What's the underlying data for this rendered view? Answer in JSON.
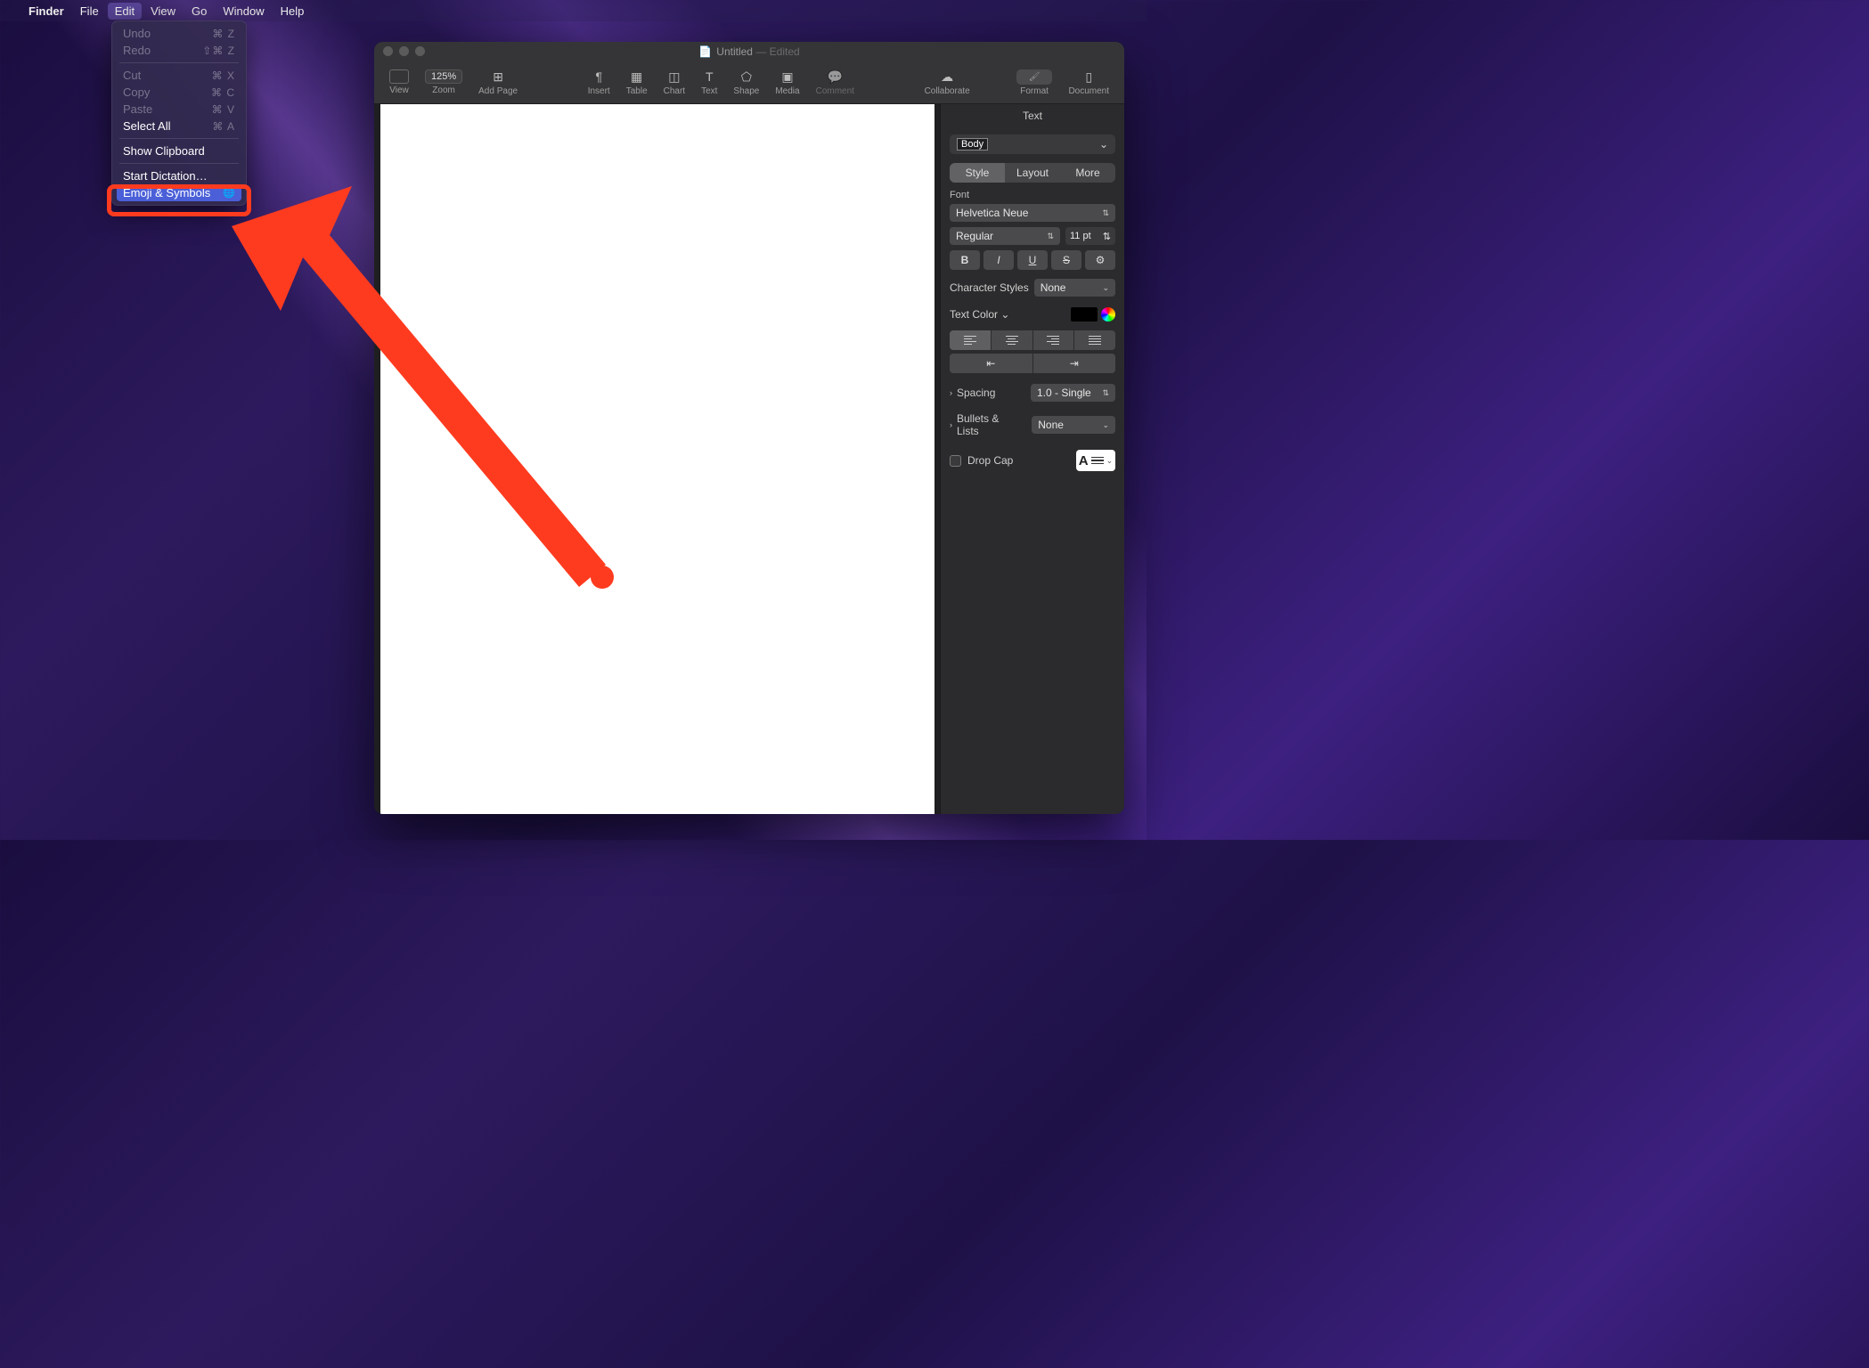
{
  "menubar": {
    "app": "Finder",
    "items": [
      "File",
      "Edit",
      "View",
      "Go",
      "Window",
      "Help"
    ],
    "active": "Edit"
  },
  "edit_menu": {
    "undo": "Undo",
    "undo_sc": "⌘ Z",
    "redo": "Redo",
    "redo_sc": "⇧⌘ Z",
    "cut": "Cut",
    "cut_sc": "⌘ X",
    "copy": "Copy",
    "copy_sc": "⌘ C",
    "paste": "Paste",
    "paste_sc": "⌘ V",
    "select_all": "Select All",
    "select_all_sc": "⌘ A",
    "show_clipboard": "Show Clipboard",
    "start_dictation": "Start Dictation…",
    "emoji": "Emoji & Symbols",
    "emoji_icon": "🌐"
  },
  "window": {
    "title": "Untitled",
    "edited": "— Edited"
  },
  "toolbar": {
    "view": "View",
    "zoom": "Zoom",
    "zoom_val": "125%",
    "add_page": "Add Page",
    "insert": "Insert",
    "table": "Table",
    "chart": "Chart",
    "text": "Text",
    "shape": "Shape",
    "media": "Media",
    "comment": "Comment",
    "collaborate": "Collaborate",
    "format": "Format",
    "document": "Document"
  },
  "inspector": {
    "title": "Text",
    "paragraph_style": "Body",
    "tabs": {
      "style": "Style",
      "layout": "Layout",
      "more": "More"
    },
    "font_label": "Font",
    "font_family": "Helvetica Neue",
    "font_weight": "Regular",
    "font_size": "11 pt",
    "char_styles_label": "Character Styles",
    "char_styles_val": "None",
    "text_color_label": "Text Color",
    "spacing_label": "Spacing",
    "spacing_val": "1.0 - Single",
    "bullets_label": "Bullets & Lists",
    "bullets_val": "None",
    "drop_cap_label": "Drop Cap"
  }
}
